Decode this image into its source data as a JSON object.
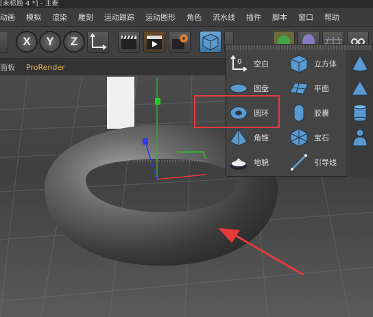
{
  "window": {
    "title": "[未标题 4 *] - 主要"
  },
  "menu": [
    "动画",
    "模拟",
    "渲染",
    "雕刻",
    "运动跟踪",
    "运动图形",
    "角色",
    "流水线",
    "插件",
    "脚本",
    "窗口",
    "帮助"
  ],
  "toolbar": {
    "axis_x": "X",
    "axis_y": "Y",
    "axis_z": "Z"
  },
  "tabs": [
    "面板",
    "ProRender"
  ],
  "popup": {
    "items": [
      {
        "label": "空白",
        "icon": "null-icon"
      },
      {
        "label": "圆盘",
        "icon": "disc-icon"
      },
      {
        "label": "圆环",
        "icon": "torus-icon"
      },
      {
        "label": "角锥",
        "icon": "pyramid-icon"
      },
      {
        "label": "地貌",
        "icon": "landscape-icon"
      },
      {
        "label": "立方体",
        "icon": "cube-icon"
      },
      {
        "label": "平面",
        "icon": "plane-icon"
      },
      {
        "label": "胶囊",
        "icon": "capsule-icon"
      },
      {
        "label": "宝石",
        "icon": "gem-icon"
      },
      {
        "label": "引导线",
        "icon": "guide-icon"
      }
    ],
    "icons_col3": [
      "cone-icon",
      "pyramid-small-icon",
      "cylinder-icon",
      "figure-icon"
    ]
  },
  "annotation": {
    "highlight_color": "#e53b3b",
    "arrow_color": "#e53b3b"
  }
}
